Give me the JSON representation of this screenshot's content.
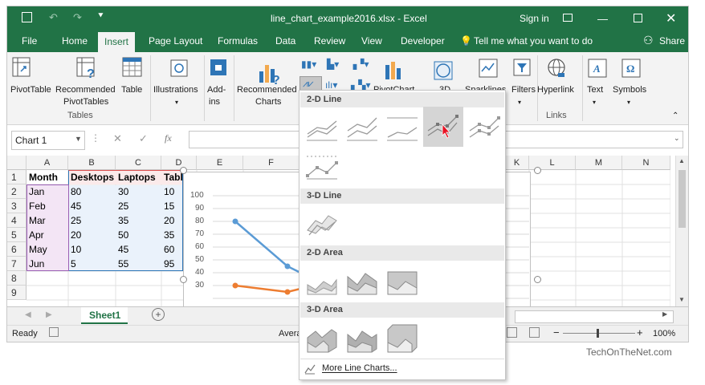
{
  "window": {
    "title": "line_chart_example2016.xlsx - Excel",
    "sign_in": "Sign in"
  },
  "tabs": [
    "File",
    "Home",
    "Insert",
    "Page Layout",
    "Formulas",
    "Data",
    "Review",
    "View",
    "Developer"
  ],
  "tell_me": "Tell me what you want to do",
  "share": "Share",
  "ribbon": {
    "pivottable": "PivotTable",
    "recommended_pivottables_1": "Recommended",
    "recommended_pivottables_2": "PivotTables",
    "table": "Table",
    "tables_group": "Tables",
    "illustrations": "Illustrations",
    "addins_1": "Add-",
    "addins_2": "ins",
    "recommended_charts_1": "Recommended",
    "recommended_charts_2": "Charts",
    "pivotchart": "PivotChart",
    "map_3d": "3D",
    "sparklines": "Sparklines",
    "filters": "Filters",
    "hyperlink": "Hyperlink",
    "links_group": "Links",
    "text": "Text",
    "symbols": "Symbols"
  },
  "formula_bar": {
    "name_box": "Chart 1",
    "fx": "fx"
  },
  "grid": {
    "columns": [
      "A",
      "B",
      "C",
      "D",
      "E",
      "F",
      "K",
      "L",
      "M",
      "N"
    ],
    "rows": [
      "1",
      "2",
      "3",
      "4",
      "5",
      "6",
      "7",
      "8",
      "9"
    ],
    "headers": [
      "Month",
      "Desktops",
      "Laptops",
      "Table"
    ],
    "data": [
      [
        "Jan",
        "80",
        "30",
        "10"
      ],
      [
        "Feb",
        "45",
        "25",
        "15"
      ],
      [
        "Mar",
        "25",
        "35",
        "20"
      ],
      [
        "Apr",
        "20",
        "50",
        "35"
      ],
      [
        "May",
        "10",
        "45",
        "60"
      ],
      [
        "Jun",
        "5",
        "55",
        "95"
      ]
    ]
  },
  "chart_axis_ticks": [
    "100",
    "90",
    "80",
    "70",
    "60",
    "50",
    "40",
    "30"
  ],
  "chart_colors": {
    "desktops": "#5b9bd5",
    "laptops": "#ed7d31"
  },
  "sheet_tab": "Sheet1",
  "status": {
    "ready": "Ready",
    "average": "Avera",
    "zoom": "100%"
  },
  "dropdown": {
    "section_2d_line": "2-D Line",
    "section_3d_line": "3-D Line",
    "section_2d_area": "2-D Area",
    "section_3d_area": "3-D Area",
    "more": "More Line Charts..."
  },
  "watermark": "TechOnTheNet.com"
}
